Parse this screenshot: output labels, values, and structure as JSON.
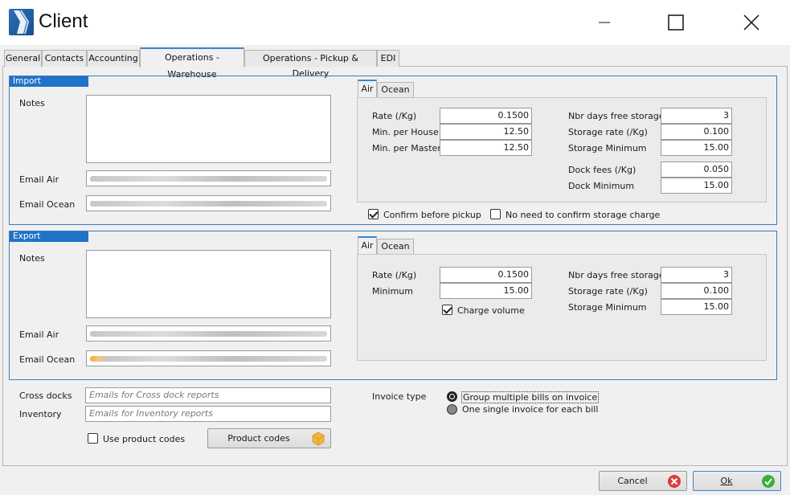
{
  "window": {
    "title": "Client",
    "icon": "app-logo-icon",
    "controls": [
      "minimize-icon",
      "maximize-icon",
      "close-icon"
    ]
  },
  "tabs": [
    {
      "label": "General"
    },
    {
      "label": "Contacts"
    },
    {
      "label": "Accounting"
    },
    {
      "label": "Operations - Warehouse",
      "active": true
    },
    {
      "label": "Operations - Pickup & Delivery"
    },
    {
      "label": "EDI"
    }
  ],
  "import": {
    "title": "Import",
    "notes_label": "Notes",
    "notes_value": "",
    "email_air_label": "Email Air",
    "email_ocean_label": "Email Ocean",
    "tabs": [
      "Air",
      "Ocean"
    ],
    "active_tab": "Air",
    "rate_label": "Rate (/Kg)",
    "rate_value": "0.1500",
    "min_house_label": "Min. per House",
    "min_house_value": "12.50",
    "min_master_label": "Min. per Master",
    "min_master_value": "12.50",
    "free_days_label": "Nbr days free storage",
    "free_days_value": "3",
    "storage_rate_label": "Storage rate (/Kg)",
    "storage_rate_value": "0.100",
    "storage_min_label": "Storage Minimum",
    "storage_min_value": "15.00",
    "dock_fees_label": "Dock fees (/Kg)",
    "dock_fees_value": "0.050",
    "dock_min_label": "Dock Minimum",
    "dock_min_value": "15.00",
    "confirm_pickup_label": "Confirm before pickup",
    "confirm_pickup_checked": true,
    "no_confirm_storage_label": "No need to confirm storage charge",
    "no_confirm_storage_checked": false
  },
  "export": {
    "title": "Export",
    "notes_label": "Notes",
    "notes_value": "",
    "email_air_label": "Email Air",
    "email_ocean_label": "Email Ocean",
    "tabs": [
      "Air",
      "Ocean"
    ],
    "active_tab": "Air",
    "rate_label": "Rate (/Kg)",
    "rate_value": "0.1500",
    "minimum_label": "Minimum",
    "minimum_value": "15.00",
    "charge_volume_label": "Charge volume",
    "charge_volume_checked": true,
    "free_days_label": "Nbr days free storage",
    "free_days_value": "3",
    "storage_rate_label": "Storage rate (/Kg)",
    "storage_rate_value": "0.100",
    "storage_min_label": "Storage Minimum",
    "storage_min_value": "15.00"
  },
  "misc": {
    "cross_docks_label": "Cross docks",
    "cross_docks_placeholder": "Emails for Cross dock reports",
    "inventory_label": "Inventory",
    "inventory_placeholder": "Emails for Inventory reports",
    "use_product_codes_label": "Use product codes",
    "use_product_codes_checked": false,
    "product_codes_button": "Product codes",
    "invoice_type_label": "Invoice type",
    "invoice_options": [
      {
        "label": "Group multiple bills on invoice",
        "selected": true
      },
      {
        "label": "One single invoice for each bill",
        "selected": false
      }
    ]
  },
  "footer": {
    "cancel_label": "Cancel",
    "ok_label": "Ok"
  },
  "colors": {
    "accent": "#3c84d1",
    "group_header": "#1f73c8",
    "cancel_icon": "#e03a3a",
    "ok_icon": "#3aae3a",
    "product_codes_icon": "#f2b640"
  }
}
